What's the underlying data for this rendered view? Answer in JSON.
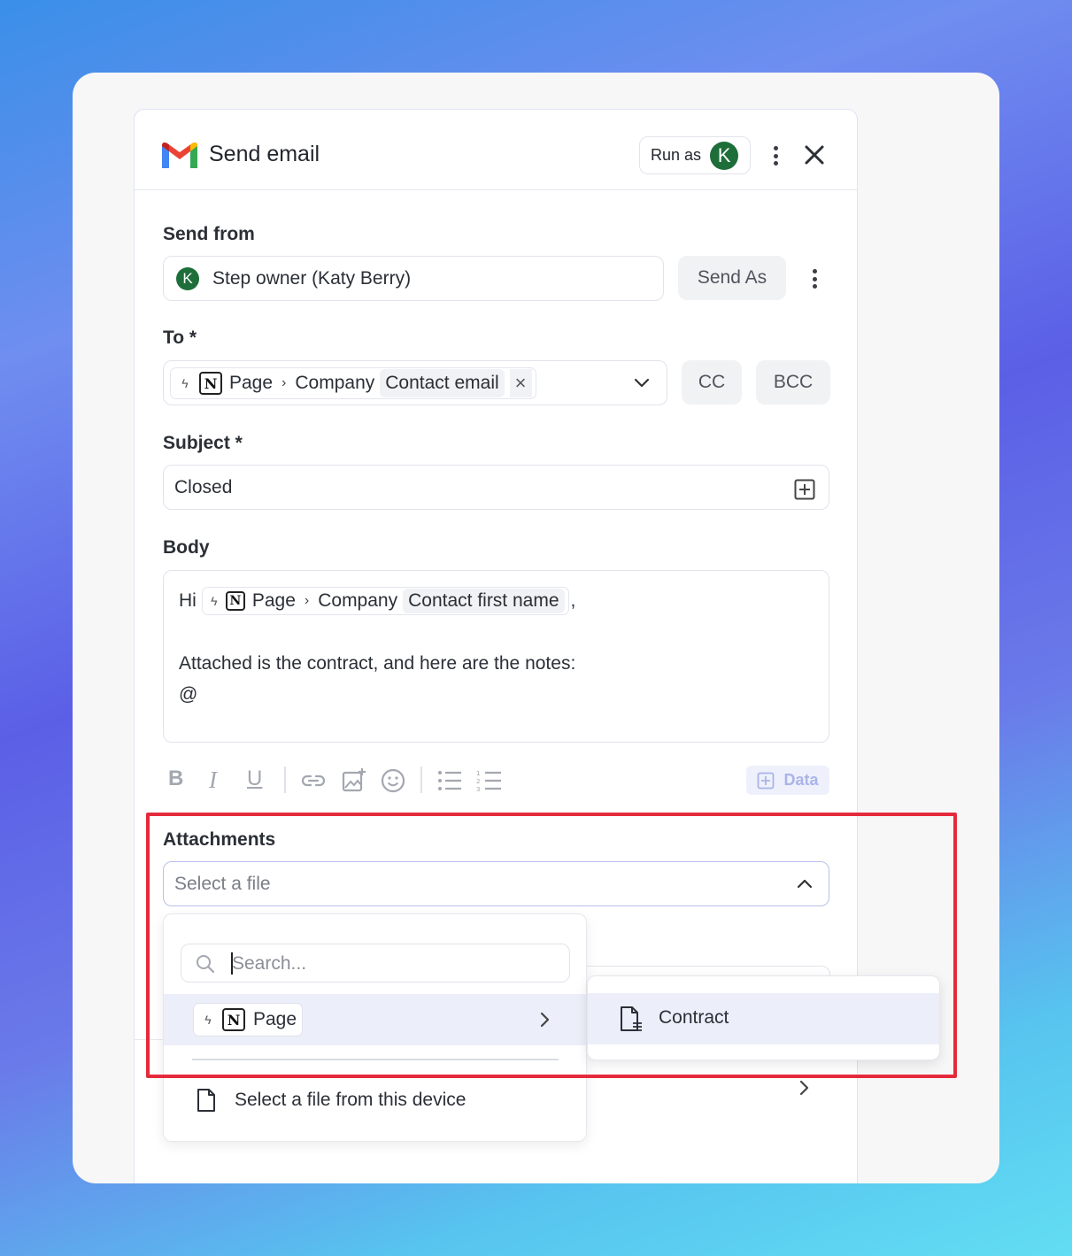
{
  "dialog": {
    "title": "Send email",
    "run_as_label": "Run as",
    "run_as_avatar": "K"
  },
  "send_from": {
    "label": "Send from",
    "avatar": "K",
    "value": "Step owner (Katy Berry)",
    "send_as_label": "Send As"
  },
  "to": {
    "label": "To *",
    "chip_page": "Page",
    "chip_company": "Company",
    "chip_field": "Contact email",
    "cc_label": "CC",
    "bcc_label": "BCC"
  },
  "subject": {
    "label": "Subject *",
    "value": "Closed"
  },
  "body": {
    "label": "Body",
    "greeting": "Hi",
    "chip_page": "Page",
    "chip_company": "Company",
    "chip_field": "Contact first name",
    "comma": ",",
    "line2": "Attached is the contract, and here are the notes:",
    "line3": "@"
  },
  "toolbar": {
    "data_label": "Data"
  },
  "attachments": {
    "label": "Attachments",
    "placeholder": "Select a file",
    "search_placeholder": "Search...",
    "page_item": "Page",
    "device_item": "Select a file from this device",
    "submenu_item": "Contract"
  },
  "colors": {
    "avatar_green": "#1e6e3a",
    "highlight_red": "#e52a3b",
    "selected_row": "#eceef9"
  }
}
